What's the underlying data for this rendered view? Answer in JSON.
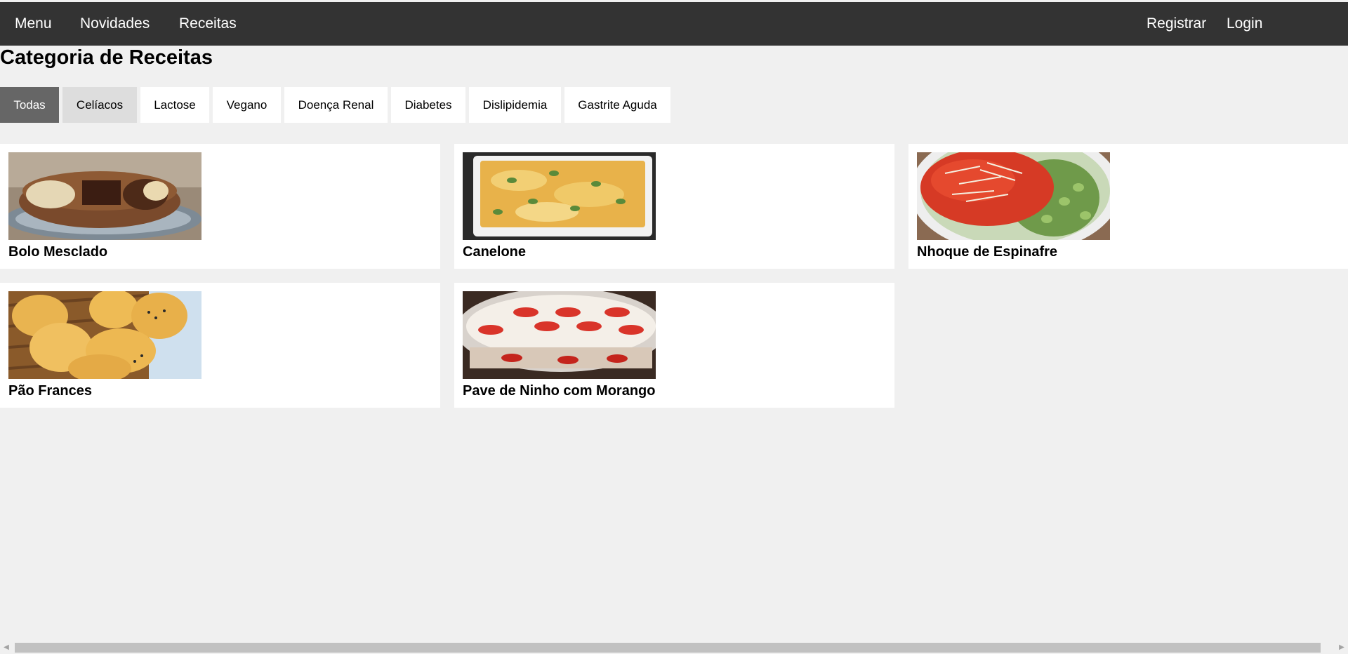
{
  "nav": {
    "menu": "Menu",
    "novidades": "Novidades",
    "receitas": "Receitas",
    "registrar": "Registrar",
    "login": "Login"
  },
  "page": {
    "title": "Categoria de Receitas"
  },
  "categories": [
    {
      "label": "Todas",
      "state": "active"
    },
    {
      "label": "Celíacos",
      "state": "hover"
    },
    {
      "label": "Lactose",
      "state": "normal"
    },
    {
      "label": "Vegano",
      "state": "normal"
    },
    {
      "label": "Doença Renal",
      "state": "normal"
    },
    {
      "label": "Diabetes",
      "state": "normal"
    },
    {
      "label": "Dislipidemia",
      "state": "normal"
    },
    {
      "label": "Gastrite Aguda",
      "state": "normal"
    }
  ],
  "recipes": [
    {
      "title": "Bolo Mesclado",
      "image": "marble-cake-photo"
    },
    {
      "title": "Canelone",
      "image": "cannelloni-photo"
    },
    {
      "title": "Nhoque de Espinafre",
      "image": "spinach-gnocchi-photo"
    },
    {
      "title": "Pão Frances",
      "image": "bread-rolls-photo"
    },
    {
      "title": "Pave de Ninho com Morango",
      "image": "strawberry-pave-photo"
    }
  ],
  "colors": {
    "topbar": "#333333",
    "page_bg": "#f0f0f0",
    "tab_active": "#666666",
    "tab_hover": "#dddddd"
  }
}
